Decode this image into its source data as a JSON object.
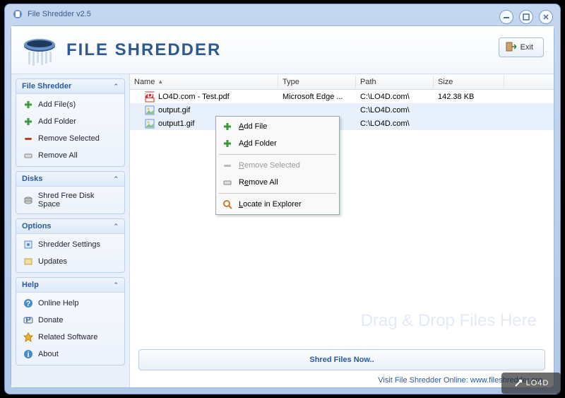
{
  "window": {
    "title": "File Shredder v2.5"
  },
  "header": {
    "brand": "File Shredder",
    "exit_label": "Exit"
  },
  "sidebar": {
    "groups": [
      {
        "title": "File Shredder",
        "items": [
          {
            "icon": "plus-icon",
            "label": "Add File(s)"
          },
          {
            "icon": "plus-icon",
            "label": "Add Folder"
          },
          {
            "icon": "minus-icon",
            "label": "Remove Selected"
          },
          {
            "icon": "eraser-icon",
            "label": "Remove All"
          }
        ]
      },
      {
        "title": "Disks",
        "items": [
          {
            "icon": "disk-icon",
            "label": "Shred Free Disk Space"
          }
        ]
      },
      {
        "title": "Options",
        "items": [
          {
            "icon": "settings-icon",
            "label": "Shredder Settings"
          },
          {
            "icon": "update-icon",
            "label": "Updates"
          }
        ]
      },
      {
        "title": "Help",
        "items": [
          {
            "icon": "help-icon",
            "label": "Online Help"
          },
          {
            "icon": "donate-icon",
            "label": "Donate"
          },
          {
            "icon": "star-icon",
            "label": "Related Software"
          },
          {
            "icon": "about-icon",
            "label": "About"
          }
        ]
      }
    ]
  },
  "columns": {
    "name": "Name",
    "type": "Type",
    "path": "Path",
    "size": "Size"
  },
  "files": [
    {
      "icon": "pdf",
      "name": "LO4D.com - Test.pdf",
      "type": "Microsoft Edge ...",
      "path": "C:\\LO4D.com\\",
      "size": "142.38 KB"
    },
    {
      "icon": "img",
      "name": "output.gif",
      "type": "",
      "path": "C:\\LO4D.com\\",
      "size": ""
    },
    {
      "icon": "img",
      "name": "output1.gif",
      "type": "",
      "path": "C:\\LO4D.com\\",
      "size": ""
    }
  ],
  "context_menu": {
    "add_file": "Add File",
    "add_folder": "Add Folder",
    "remove_selected": "Remove Selected",
    "remove_all": "Remove All",
    "locate": "Locate in Explorer"
  },
  "watermark": "Drag & Drop Files Here",
  "shred_button": "Shred Files Now..",
  "footer": {
    "text": "Visit File Shredder Online: ",
    "link": "www.fileshredder.org"
  },
  "badge": "LO4D"
}
